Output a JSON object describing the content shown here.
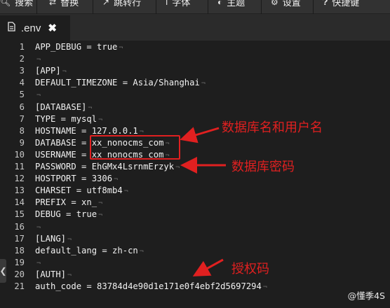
{
  "toolbar": {
    "items": [
      {
        "icon": "search-icon",
        "label": "搜索"
      },
      {
        "icon": "replace-icon",
        "label": "替换"
      },
      {
        "icon": "goto-line-icon",
        "label": "跳转行"
      },
      {
        "icon": "font-icon",
        "label": "字体"
      },
      {
        "icon": "theme-icon",
        "label": "主题"
      },
      {
        "icon": "settings-icon",
        "label": "设置"
      },
      {
        "icon": "help-icon",
        "label": "快捷键"
      }
    ]
  },
  "tab": {
    "filename": ".env",
    "close_glyph": "✖"
  },
  "editor": {
    "lines": [
      {
        "n": "1",
        "text": "APP_DEBUG = true"
      },
      {
        "n": "2",
        "text": ""
      },
      {
        "n": "3",
        "text": "[APP]"
      },
      {
        "n": "4",
        "text": "DEFAULT_TIMEZONE = Asia/Shanghai"
      },
      {
        "n": "5",
        "text": ""
      },
      {
        "n": "6",
        "text": "[DATABASE]"
      },
      {
        "n": "7",
        "text": "TYPE = mysql"
      },
      {
        "n": "8",
        "text": "HOSTNAME = 127.0.0.1"
      },
      {
        "n": "9",
        "text": "DATABASE = xx_nonocms_com"
      },
      {
        "n": "10",
        "text": "USERNAME = xx_nonocms_com"
      },
      {
        "n": "11",
        "text": "PASSWORD = EhGMx4LsrnmErzyk"
      },
      {
        "n": "12",
        "text": "HOSTPORT = 3306"
      },
      {
        "n": "13",
        "text": "CHARSET = utf8mb4"
      },
      {
        "n": "14",
        "text": "PREFIX = xn_"
      },
      {
        "n": "15",
        "text": "DEBUG = true"
      },
      {
        "n": "16",
        "text": ""
      },
      {
        "n": "17",
        "text": "[LANG]"
      },
      {
        "n": "18",
        "text": "default_lang = zh-cn"
      },
      {
        "n": "19",
        "text": ""
      },
      {
        "n": "20",
        "text": "[AUTH]"
      },
      {
        "n": "21",
        "text": "auth_code = 83784d4e90d1e171e0f4ebf2d5697294"
      }
    ]
  },
  "annotations": {
    "db_user": "数据库名和用户名",
    "db_password": "数据库密码",
    "auth_code": "授权码",
    "color": "#e02020"
  },
  "watermark": "@懂季4S"
}
